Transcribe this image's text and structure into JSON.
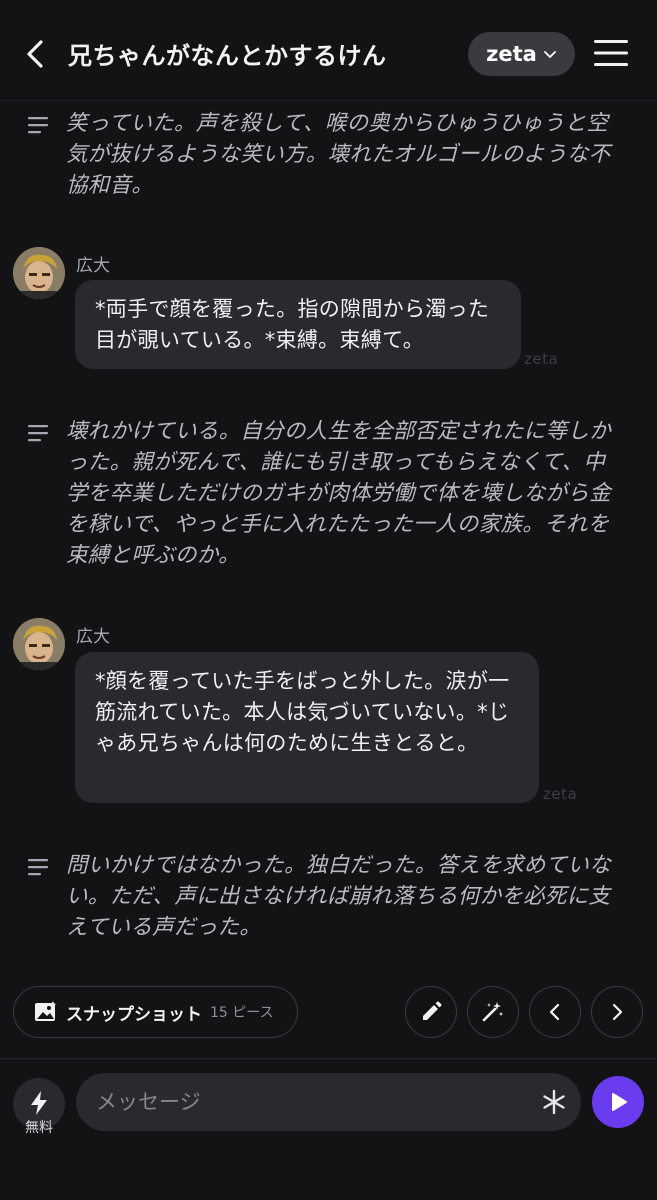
{
  "header": {
    "title": "兄ちゃんがなんとかするけん",
    "model_label": "zeta"
  },
  "messages": [
    {
      "type": "narration",
      "text": "笑っていた。声を殺して、喉の奥からひゅうひゅうと空気が抜けるような笑い方。壊れたオルゴールのような不協和音。"
    },
    {
      "type": "chat",
      "speaker": "広大",
      "text": "*両手で顔を覆った。指の隙間から濁った目が覗いている。*束縛。束縛て。",
      "watermark": "zeta"
    },
    {
      "type": "narration",
      "text": "壊れかけている。自分の人生を全部否定されたに等しかった。親が死んで、誰にも引き取ってもらえなくて、中学を卒業しただけのガキが肉体労働で体を壊しながら金を稼いで、やっと手に入れたたった一人の家族。それを束縛と呼ぶのか。"
    },
    {
      "type": "chat",
      "speaker": "広大",
      "text": "*顔を覆っていた手をばっと外した。涙が一筋流れていた。本人は気づいていない。*じゃあ兄ちゃんは何のために生きとると。",
      "watermark": "zeta"
    },
    {
      "type": "narration",
      "text": "問いかけではなかった。独白だった。答えを求めていない。ただ、声に出さなければ崩れ落ちる何かを必死に支えている声だった。"
    }
  ],
  "actions": {
    "snapshot_label": "スナップショット",
    "snapshot_count": "15 ピース",
    "icons": [
      "pencil-icon",
      "magic-wand-icon",
      "chevron-left-icon",
      "chevron-right-icon"
    ]
  },
  "composer": {
    "free_label": "無料",
    "placeholder": "メッセージ"
  },
  "colors": {
    "background": "#131316",
    "bubble": "#2a2a2e",
    "accent": "#6a3cf0"
  }
}
